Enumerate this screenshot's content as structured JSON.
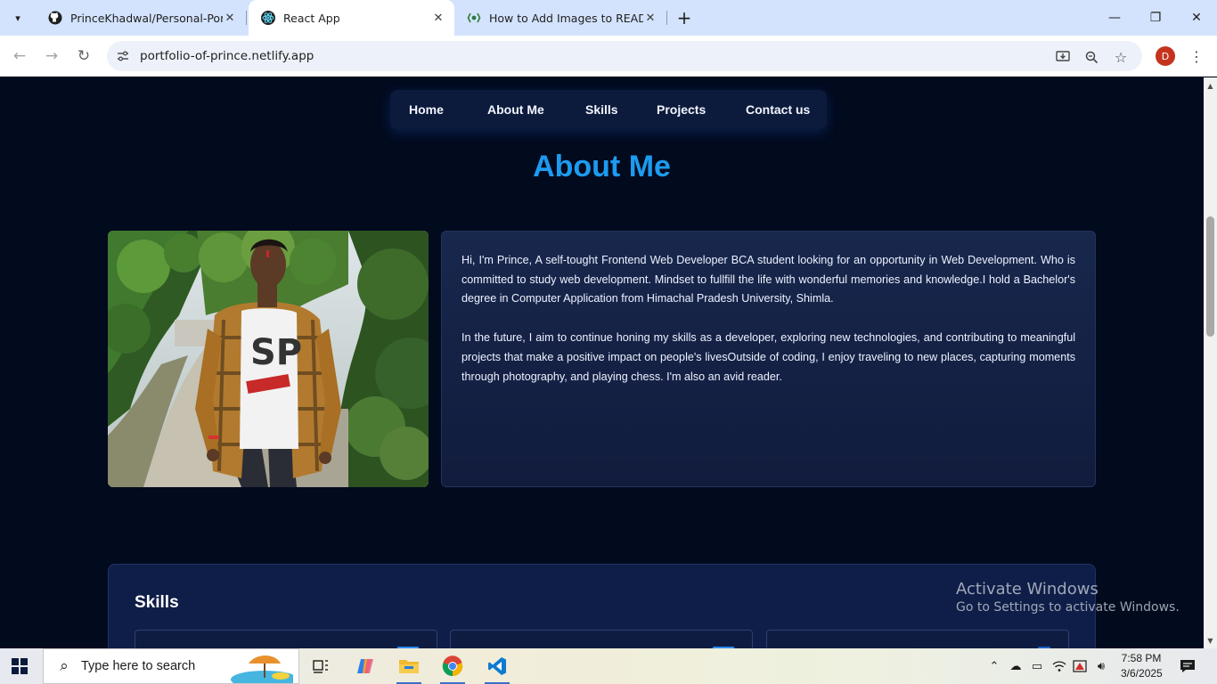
{
  "browser": {
    "tabs": [
      {
        "title": "PrinceKhadwal/Personal-Portfolio",
        "active": false,
        "favicon": "github-icon"
      },
      {
        "title": "React App",
        "active": true,
        "favicon": "react-icon"
      },
      {
        "title": "How to Add Images to README",
        "active": false,
        "favicon": "freecodecamp-icon"
      }
    ],
    "url": "portfolio-of-prince.netlify.app",
    "profile_initial": "D"
  },
  "site": {
    "nav": [
      "Home",
      "About Me",
      "Skills",
      "Projects",
      "Contact us"
    ],
    "about_title": "About Me",
    "about_paragraphs": [
      "Hi, I'm Prince, A self-tought Frontend Web Developer BCA student looking for an opportunity in Web Development. Who is committed to study web development. Mindset to fullfill the life with wonderful memories and knowledge.I hold a Bachelor's degree in Computer Application from Himachal Pradesh University, Shimla.",
      "In the future, I aim to continue honing my skills as a developer, exploring new technologies, and contributing to meaningful projects that make a positive impact on people's livesOutside of coding, I enjoy traveling to new places, capturing moments through photography, and playing chess. I'm also an avid reader."
    ],
    "skills_title": "Skills"
  },
  "watermark": {
    "line1": "Activate Windows",
    "line2": "Go to Settings to activate Windows."
  },
  "taskbar": {
    "search_placeholder": "Type here to search",
    "time": "7:58 PM",
    "date": "3/6/2025"
  },
  "colors": {
    "accent": "#1c9bf0",
    "page_bg": "#020a1e",
    "card_bg": "#16244a",
    "nav_bg": "#0c1a3b"
  }
}
